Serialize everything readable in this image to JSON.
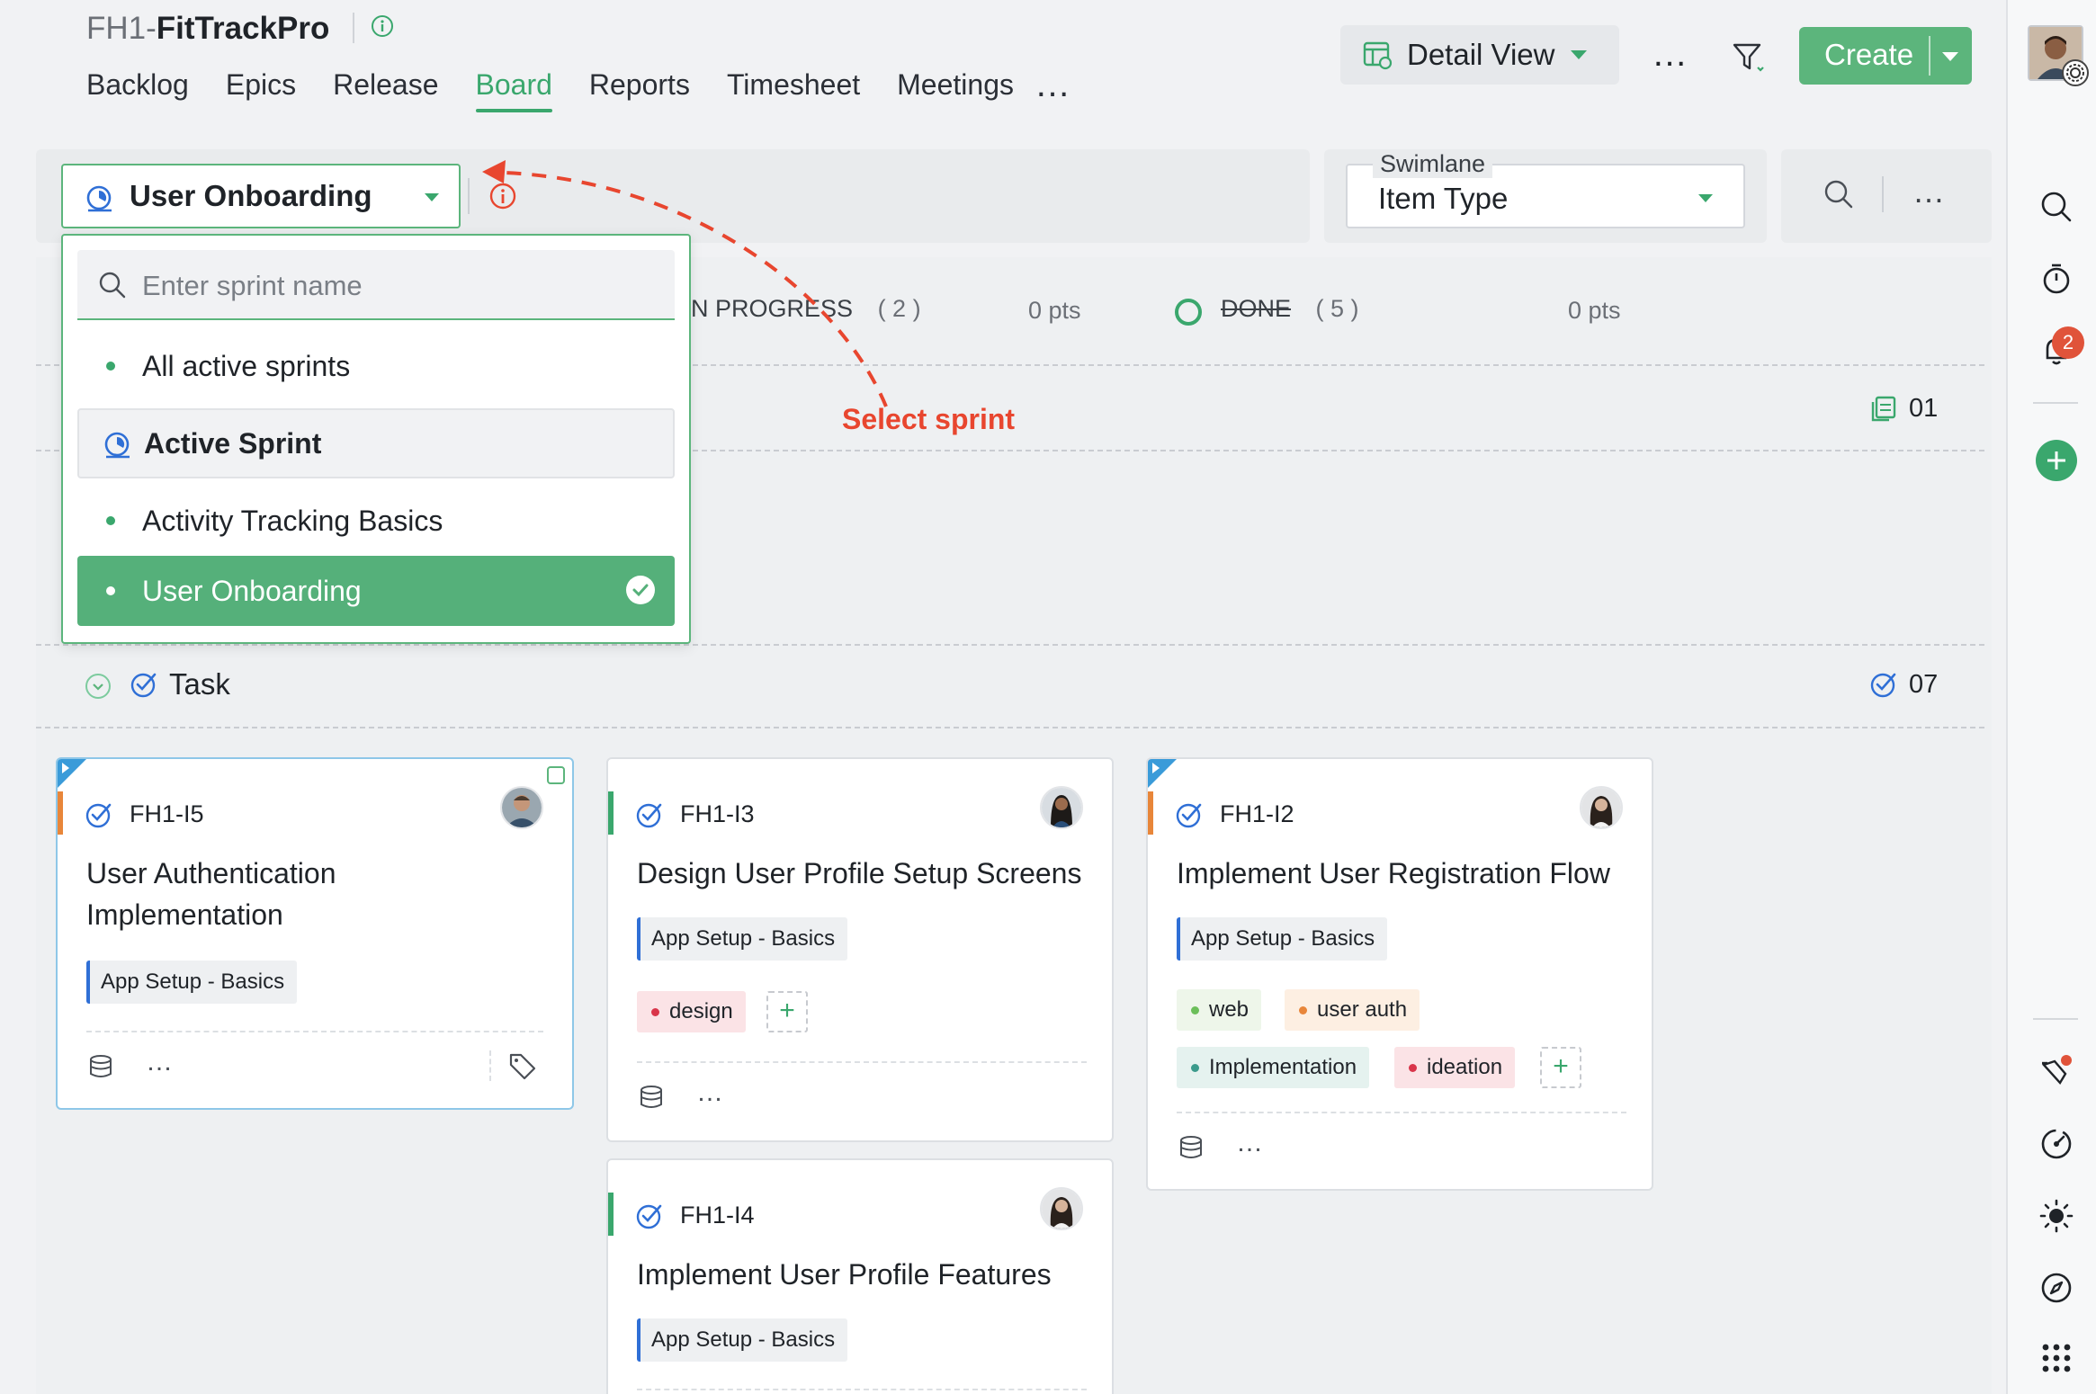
{
  "project": {
    "code": "FH1-",
    "name": "FitTrackPro"
  },
  "nav": {
    "items": [
      "Backlog",
      "Epics",
      "Release",
      "Board",
      "Reports",
      "Timesheet",
      "Meetings"
    ],
    "active": "Board",
    "more": "…"
  },
  "header": {
    "view_label": "Detail View",
    "more": "…",
    "create_label": "Create"
  },
  "toolbar": {
    "sprint_selected": "User Onboarding",
    "swimlane_legend": "Swimlane",
    "swimlane_value": "Item Type",
    "more": "…"
  },
  "columns": {
    "in_progress": {
      "label": "N PROGRESS",
      "count": "( 2 )",
      "pts": "0 pts"
    },
    "done": {
      "label": "DONE",
      "count": "( 5 )",
      "pts": "0 pts"
    }
  },
  "lanes": {
    "first_count": "01",
    "task": {
      "label": "Task",
      "count": "07"
    }
  },
  "dropdown": {
    "search_placeholder": "Enter sprint name",
    "items": [
      "All active sprints",
      "Active Sprint",
      "Activity Tracking Basics",
      "User Onboarding"
    ],
    "header_item": "Active Sprint",
    "selected_item": "User Onboarding"
  },
  "annotation": {
    "text": "Select sprint",
    "color": "#e8462f"
  },
  "cards": [
    {
      "id": "FH1-I5",
      "title_lines": [
        "User Authentication",
        "Implementation"
      ],
      "epic": "App Setup - Basics",
      "priority_color": "#e8863a",
      "more": "…"
    },
    {
      "id": "FH1-I3",
      "title": "Design User Profile Setup Screens",
      "epic": "App Setup - Basics",
      "tags": [
        {
          "label": "design",
          "color": "#d9354a",
          "bg": "#fbe3e6"
        }
      ],
      "priority_color": "#3aa76d",
      "more": "…"
    },
    {
      "id": "FH1-I2",
      "title": "Implement User Registration Flow",
      "epic": "App Setup - Basics",
      "tags": [
        {
          "label": "web",
          "color": "#6cbf5a",
          "bg": "#eef6ea"
        },
        {
          "label": "user auth",
          "color": "#e8863a",
          "bg": "#fdefe2"
        },
        {
          "label": "Implementation",
          "color": "#3b9b8c",
          "bg": "#e5f2ef"
        },
        {
          "label": "ideation",
          "color": "#d9354a",
          "bg": "#fbe3e6"
        }
      ],
      "priority_color": "#e8863a",
      "more": "…"
    },
    {
      "id": "FH1-I4",
      "title": "Implement User Profile Features",
      "epic": "App Setup - Basics",
      "priority_color": "#3aa76d"
    }
  ],
  "rail": {
    "notification_count": "2"
  },
  "colors": {
    "accent": "#3aa76d",
    "create": "#5cb57c",
    "link_blue": "#2f6fd6"
  }
}
